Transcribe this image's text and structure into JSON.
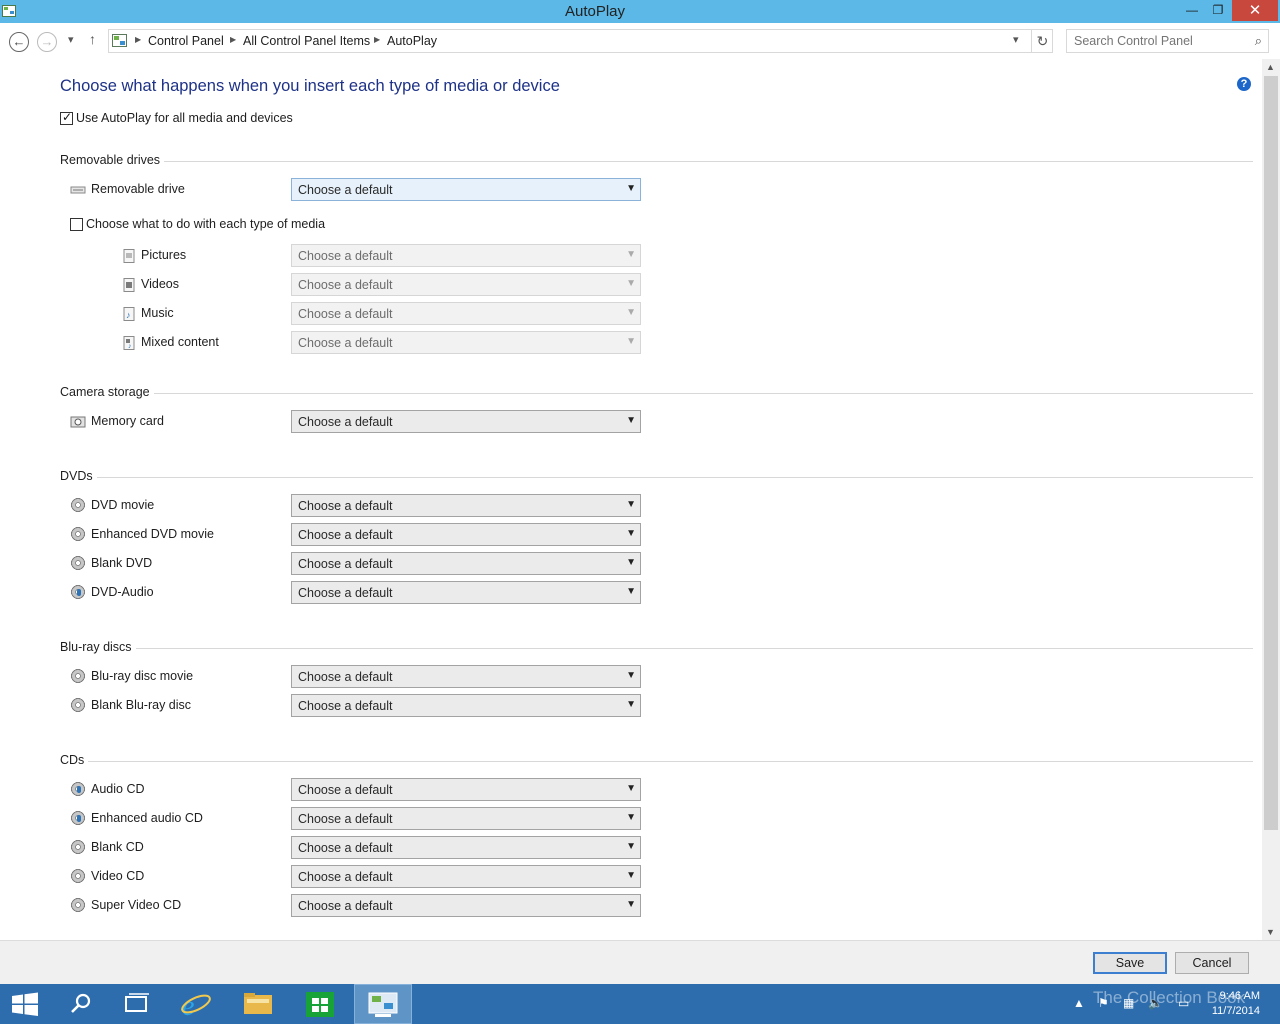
{
  "window": {
    "title": "AutoPlay",
    "minimize": "—",
    "maximize": "❐",
    "close": "✕"
  },
  "address": {
    "breadcrumbs": [
      "Control Panel",
      "All Control Panel Items",
      "AutoPlay"
    ],
    "search_placeholder": "Search Control Panel"
  },
  "page": {
    "heading": "Choose what happens when you insert each type of media or device",
    "help": "?",
    "use_autoplay_label": "Use AutoPlay for all media and devices",
    "use_autoplay_checked": true
  },
  "removable": {
    "title": "Removable drives",
    "drive_label": "Removable drive",
    "drive_value": "Choose a default",
    "each_media_label": "Choose what to do with each type of media",
    "each_media_checked": false,
    "media": [
      {
        "label": "Pictures",
        "value": "Choose a default"
      },
      {
        "label": "Videos",
        "value": "Choose a default"
      },
      {
        "label": "Music",
        "value": "Choose a default"
      },
      {
        "label": "Mixed content",
        "value": "Choose a default"
      }
    ]
  },
  "camera": {
    "title": "Camera storage",
    "items": [
      {
        "label": "Memory card",
        "value": "Choose a default"
      }
    ]
  },
  "dvds": {
    "title": "DVDs",
    "items": [
      {
        "label": "DVD movie",
        "value": "Choose a default"
      },
      {
        "label": "Enhanced DVD movie",
        "value": "Choose a default"
      },
      {
        "label": "Blank DVD",
        "value": "Choose a default"
      },
      {
        "label": "DVD-Audio",
        "value": "Choose a default"
      }
    ]
  },
  "bluray": {
    "title": "Blu-ray discs",
    "items": [
      {
        "label": "Blu-ray disc movie",
        "value": "Choose a default"
      },
      {
        "label": "Blank Blu-ray disc",
        "value": "Choose a default"
      }
    ]
  },
  "cds": {
    "title": "CDs",
    "items": [
      {
        "label": "Audio CD",
        "value": "Choose a default"
      },
      {
        "label": "Enhanced audio CD",
        "value": "Choose a default"
      },
      {
        "label": "Blank CD",
        "value": "Choose a default"
      },
      {
        "label": "Video CD",
        "value": "Choose a default"
      },
      {
        "label": "Super Video CD",
        "value": "Choose a default"
      }
    ]
  },
  "buttons": {
    "save": "Save",
    "cancel": "Cancel"
  },
  "taskbar": {
    "time": "9:46 AM",
    "date": "11/7/2014",
    "watermark": "The Collection Book"
  },
  "colors": {
    "titlebar": "#5cb8e6",
    "heading": "#1e3287",
    "taskbar": "#2d6dae",
    "close": "#c9483e"
  }
}
